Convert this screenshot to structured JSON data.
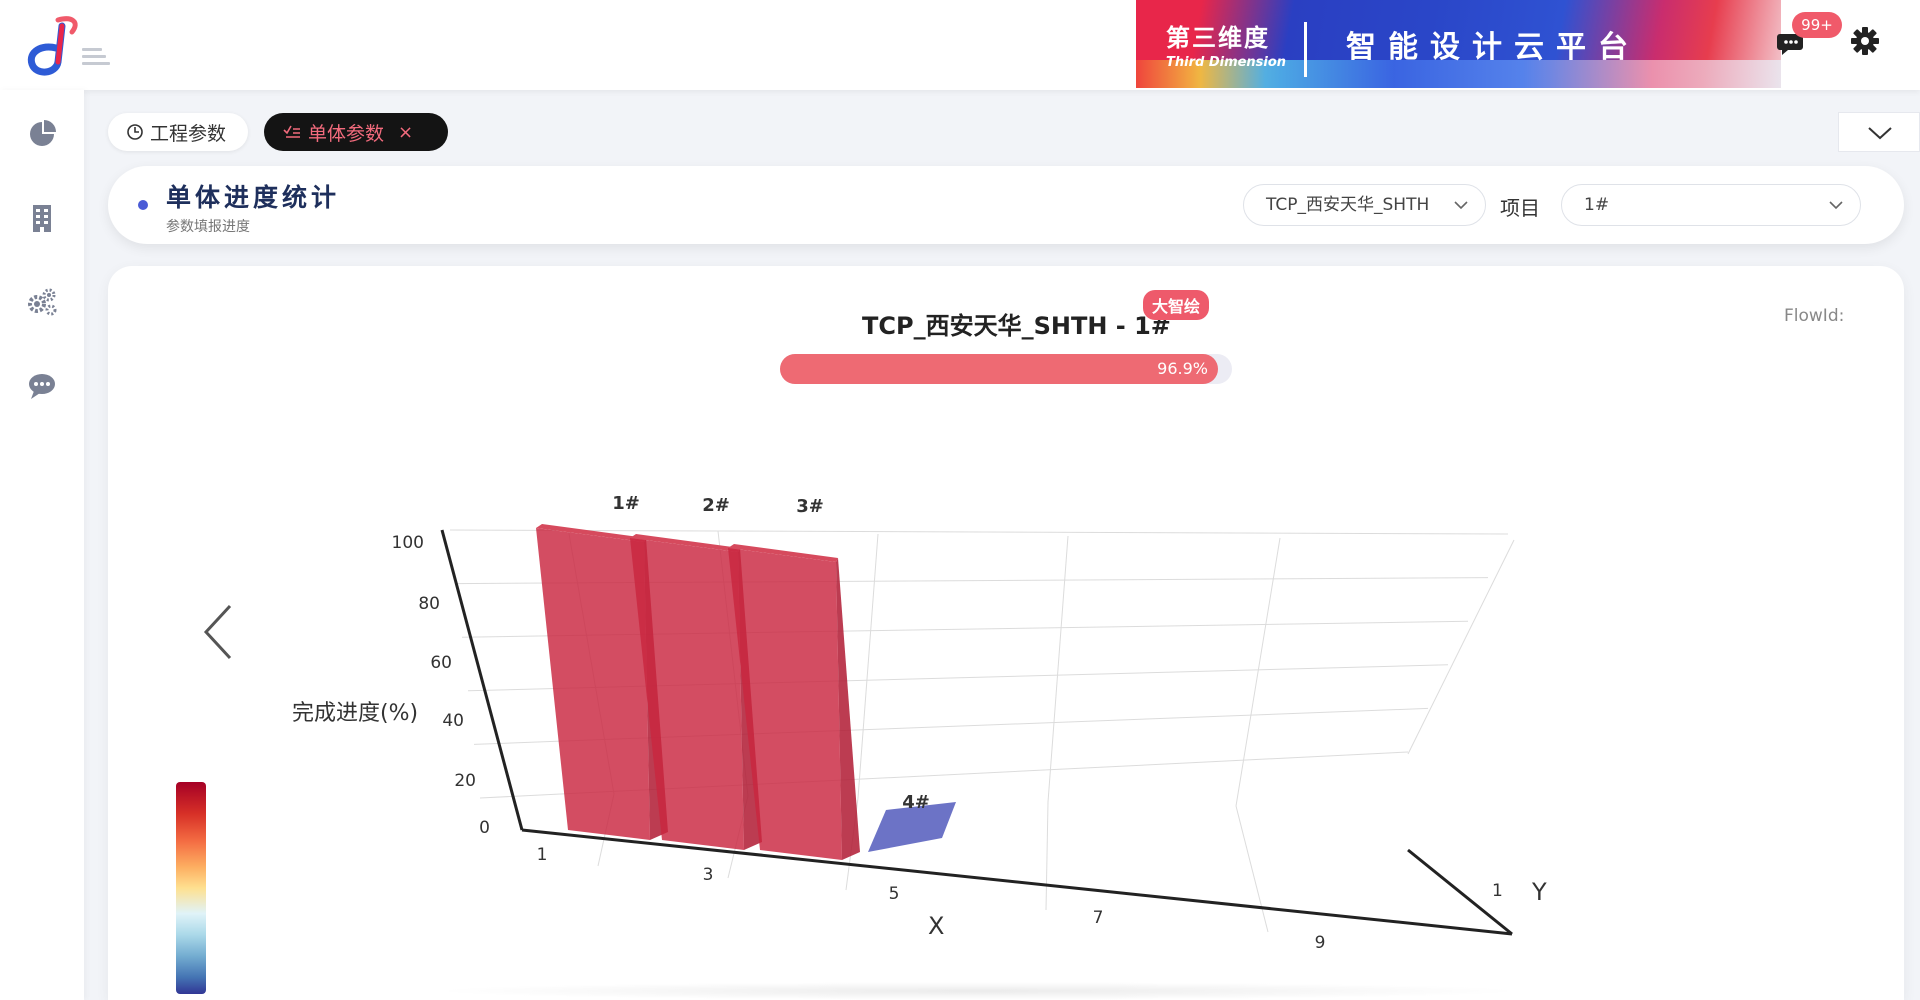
{
  "header": {
    "banner_title_cn": "第三维度",
    "banner_title_en": "Third Dimension",
    "banner_slogan": "智能设计云平台",
    "notifications_badge": "99+"
  },
  "sidebar": {
    "items": [
      {
        "icon": "pie-chart-icon"
      },
      {
        "icon": "building-icon"
      },
      {
        "icon": "gears-icon"
      },
      {
        "icon": "chat-bubble-icon"
      }
    ]
  },
  "tabs": [
    {
      "label": "工程参数",
      "icon": "clock-icon",
      "active": false
    },
    {
      "label": "单体参数",
      "icon": "checklist-icon",
      "active": true,
      "close": "×"
    }
  ],
  "stats": {
    "title": "单体进度统计",
    "subtitle": "参数填报进度",
    "flow_select": "TCP_西安天华_SHTH",
    "project_label": "项目",
    "project_select": "1#"
  },
  "chart_panel": {
    "title": "TCP_西安天华_SHTH - 1#",
    "tag": "大智绘",
    "flowid_label": "FlowId:",
    "progress_value": 96.9,
    "progress_text": "96.9%"
  },
  "colors": {
    "accent": "#ee6a73",
    "bar_high": "#c9263f",
    "bar_low": "#5c64c0",
    "title_navy": "#1e2f5c"
  },
  "chart_data": {
    "type": "bar3d",
    "zlabel": "完成进度(%)",
    "xlabel": "X",
    "ylabel": "Y",
    "z_ticks": [
      "0",
      "20",
      "40",
      "60",
      "80",
      "100"
    ],
    "x_ticks": [
      "1",
      "3",
      "5",
      "7",
      "9"
    ],
    "y_ticks": [
      "1"
    ],
    "zlim": [
      0,
      100
    ],
    "bars": [
      {
        "label": "1#",
        "x": 1,
        "y": 1,
        "value": 100
      },
      {
        "label": "2#",
        "x": 2,
        "y": 1,
        "value": 100
      },
      {
        "label": "3#",
        "x": 3,
        "y": 1,
        "value": 100
      },
      {
        "label": "4#",
        "x": 4,
        "y": 1,
        "value": 0
      }
    ],
    "visual_map": {
      "type": "continuous",
      "colors": [
        "#313695",
        "#4575b4",
        "#74add1",
        "#abd9e9",
        "#e0f3f8",
        "#fee090",
        "#fdae61",
        "#f46d43",
        "#d73027",
        "#a50026"
      ]
    }
  }
}
